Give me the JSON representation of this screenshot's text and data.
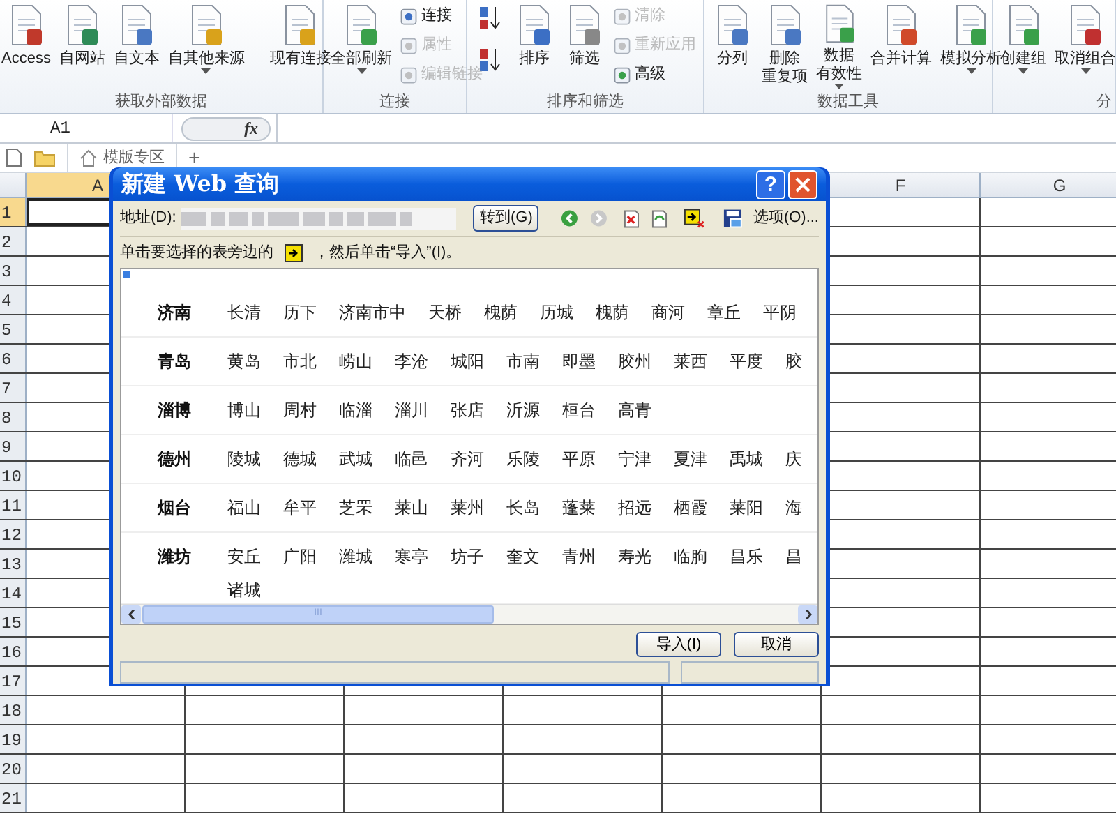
{
  "ribbon": {
    "groups": [
      {
        "label": "获取外部数据",
        "items": [
          {
            "kind": "large",
            "lines": [
              "Access"
            ],
            "dropdown": false
          },
          {
            "kind": "large",
            "lines": [
              "自网站"
            ],
            "dropdown": false
          },
          {
            "kind": "large",
            "lines": [
              "自文本"
            ],
            "dropdown": false
          },
          {
            "kind": "large",
            "lines": [
              "自其他来源"
            ],
            "dropdown": true
          },
          {
            "kind": "separator"
          },
          {
            "kind": "large",
            "lines": [
              "现有连接"
            ],
            "dropdown": false
          }
        ]
      },
      {
        "label": "连接",
        "items": [
          {
            "kind": "large",
            "lines": [
              "全部刷新"
            ],
            "dropdown": true
          },
          {
            "kind": "small-stack",
            "entries": [
              {
                "label": "连接",
                "disabled": false
              },
              {
                "label": "属性",
                "disabled": true
              },
              {
                "label": "编辑链接",
                "disabled": true
              }
            ]
          }
        ]
      },
      {
        "label": "排序和筛选",
        "items": [
          {
            "kind": "sort-pair"
          },
          {
            "kind": "large",
            "lines": [
              "排序"
            ],
            "dropdown": false
          },
          {
            "kind": "large",
            "lines": [
              "筛选"
            ],
            "dropdown": false
          },
          {
            "kind": "small-stack",
            "entries": [
              {
                "label": "清除",
                "disabled": true
              },
              {
                "label": "重新应用",
                "disabled": true
              },
              {
                "label": "高级",
                "disabled": false
              }
            ]
          }
        ]
      },
      {
        "label": "数据工具",
        "items": [
          {
            "kind": "large",
            "lines": [
              "分列"
            ],
            "dropdown": false
          },
          {
            "kind": "large",
            "lines": [
              "删除",
              "重复项"
            ],
            "dropdown": false
          },
          {
            "kind": "large",
            "lines": [
              "数据",
              "有效性"
            ],
            "dropdown": true
          },
          {
            "kind": "large",
            "lines": [
              "合并计算"
            ],
            "dropdown": false
          },
          {
            "kind": "large",
            "lines": [
              "模拟分析"
            ],
            "dropdown": true
          }
        ]
      },
      {
        "label": "分",
        "items": [
          {
            "kind": "large",
            "lines": [
              "创建组"
            ],
            "dropdown": true
          },
          {
            "kind": "large",
            "lines": [
              "取消组合"
            ],
            "dropdown": true
          }
        ]
      }
    ]
  },
  "formula_bar": {
    "name_box": "A1",
    "fx": "fx"
  },
  "doc_tabs": {
    "tabs": [
      {
        "label": "模版专区",
        "selected": true
      }
    ],
    "add": "+"
  },
  "sheet": {
    "columns": [
      {
        "label": "A",
        "selected": true
      },
      {
        "label": "F",
        "selected": false
      },
      {
        "label": "G",
        "selected": false
      }
    ],
    "rows": [
      {
        "label": "1",
        "selected": true
      },
      {
        "label": "2",
        "selected": false
      },
      {
        "label": "3",
        "selected": false
      },
      {
        "label": "4",
        "selected": false
      },
      {
        "label": "5",
        "selected": false
      },
      {
        "label": "6",
        "selected": false
      },
      {
        "label": "7",
        "selected": false
      },
      {
        "label": "8",
        "selected": false
      },
      {
        "label": "9",
        "selected": false
      },
      {
        "label": "10",
        "selected": false
      },
      {
        "label": "11",
        "selected": false
      },
      {
        "label": "12",
        "selected": false
      },
      {
        "label": "13",
        "selected": false
      },
      {
        "label": "14",
        "selected": false
      },
      {
        "label": "15",
        "selected": false
      },
      {
        "label": "16",
        "selected": false
      },
      {
        "label": "17",
        "selected": false
      },
      {
        "label": "18",
        "selected": false
      },
      {
        "label": "19",
        "selected": false
      },
      {
        "label": "20",
        "selected": false
      },
      {
        "label": "21",
        "selected": false
      }
    ]
  },
  "dialog": {
    "title": "新建 Web 查询",
    "help": "?",
    "address_label": "地址(D):",
    "go_button": "转到(G)",
    "options_button": "选项(O)...",
    "instruction_before": "单击要选择的表旁边的",
    "instruction_after": "，然后单击“导入”(I)。",
    "table": [
      {
        "city": "济南",
        "lines": [
          [
            "长清",
            "历下",
            "济南市中",
            "天桥",
            "槐荫",
            "历城",
            "槐荫",
            "商河",
            "章丘",
            "平阴"
          ]
        ]
      },
      {
        "city": "青岛",
        "lines": [
          [
            "黄岛",
            "市北",
            "崂山",
            "李沧",
            "城阳",
            "市南",
            "即墨",
            "胶州",
            "莱西",
            "平度",
            "胶"
          ]
        ]
      },
      {
        "city": "淄博",
        "lines": [
          [
            "博山",
            "周村",
            "临淄",
            "淄川",
            "张店",
            "沂源",
            "桓台",
            "高青"
          ]
        ]
      },
      {
        "city": "德州",
        "lines": [
          [
            "陵城",
            "德城",
            "武城",
            "临邑",
            "齐河",
            "乐陵",
            "平原",
            "宁津",
            "夏津",
            "禹城",
            "庆"
          ]
        ]
      },
      {
        "city": "烟台",
        "lines": [
          [
            "福山",
            "牟平",
            "芝罘",
            "莱山",
            "莱州",
            "长岛",
            "蓬莱",
            "招远",
            "栖霞",
            "莱阳",
            "海"
          ]
        ]
      },
      {
        "city": "潍坊",
        "lines": [
          [
            "安丘",
            "广阳",
            "潍城",
            "寒亭",
            "坊子",
            "奎文",
            "青州",
            "寿光",
            "临朐",
            "昌乐",
            "昌"
          ],
          [
            "诸城"
          ]
        ]
      }
    ],
    "scroll_grip": "III",
    "import_button": "导入(I)",
    "cancel_button": "取消"
  }
}
